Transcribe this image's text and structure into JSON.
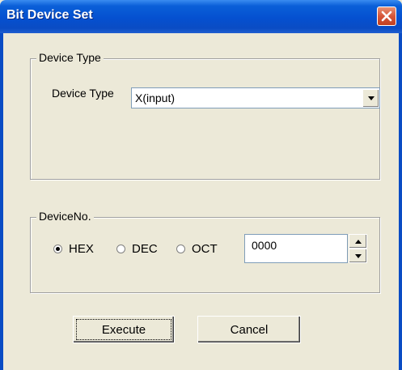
{
  "window": {
    "title": "Bit Device Set"
  },
  "device_type_group": {
    "label": "Device Type",
    "field_label": "Device Type",
    "selected": "X(input)"
  },
  "device_no_group": {
    "label": "DeviceNo.",
    "radios": [
      {
        "label": "HEX",
        "checked": true
      },
      {
        "label": "DEC",
        "checked": false
      },
      {
        "label": "OCT",
        "checked": false
      }
    ],
    "value": "0000"
  },
  "buttons": {
    "execute": "Execute",
    "cancel": "Cancel"
  },
  "icons": {
    "close": "close-icon",
    "dropdown": "chevron-down-icon",
    "spin_up": "arrow-up-icon",
    "spin_down": "arrow-down-icon"
  },
  "colors": {
    "titlebar": "#0550d0",
    "close": "#d6563a",
    "face": "#ece9d8"
  }
}
